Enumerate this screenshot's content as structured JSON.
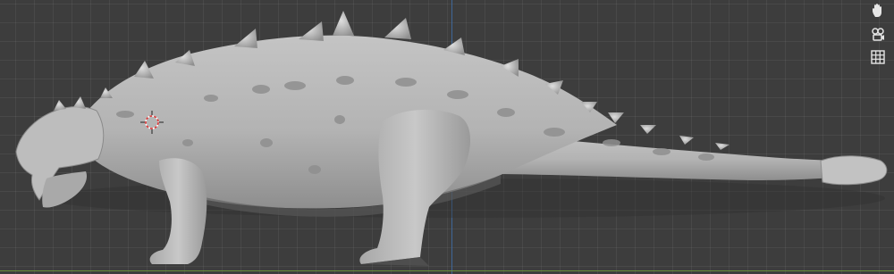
{
  "viewport": {
    "name": "3D Viewport",
    "grid": true,
    "colors": {
      "background": "#3d3d3d",
      "grid_line": "#4a4a4a",
      "axis_y": "#3f6fa8",
      "axis_x": "#6f9a3a",
      "model_surface": "#b5b5b5",
      "model_shadow": "#6e6e6e"
    },
    "model": {
      "subject": "ankylosaur-sculpt"
    },
    "cursor": {
      "icon": "3d-cursor-icon"
    }
  },
  "navigation": {
    "buttons": [
      {
        "icon": "hand-pan-icon"
      },
      {
        "icon": "camera-view-icon"
      },
      {
        "icon": "grid-toggle-icon"
      }
    ]
  }
}
